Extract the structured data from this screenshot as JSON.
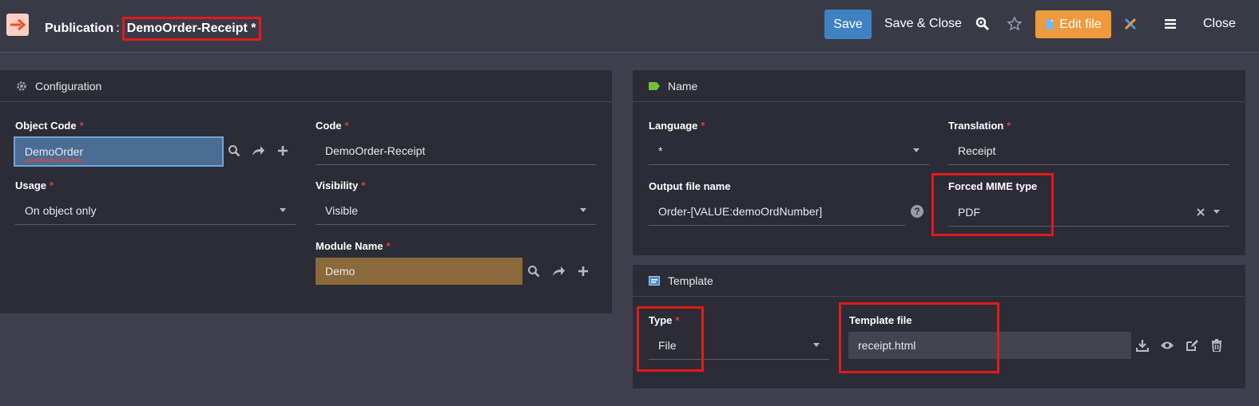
{
  "header": {
    "object_type": "Publication",
    "separator": ":",
    "record_name": "DemoOrder-Receipt *",
    "save_label": "Save",
    "save_close_label": "Save & Close",
    "edit_file_label": "Edit file",
    "close_label": "Close"
  },
  "configuration": {
    "title": "Configuration",
    "object_code": {
      "label": "Object Code",
      "value": "DemoOrder"
    },
    "code": {
      "label": "Code",
      "value": "DemoOrder-Receipt"
    },
    "usage": {
      "label": "Usage",
      "value": "On object only"
    },
    "visibility": {
      "label": "Visibility",
      "value": "Visible"
    },
    "module_name": {
      "label": "Module Name",
      "value": "Demo"
    }
  },
  "name_panel": {
    "title": "Name",
    "language": {
      "label": "Language",
      "value": "*"
    },
    "translation": {
      "label": "Translation",
      "value": "Receipt"
    },
    "output_file_name": {
      "label": "Output file name",
      "value": "Order-[VALUE:demoOrdNumber]"
    },
    "forced_mime": {
      "label": "Forced MIME type",
      "value": "PDF"
    }
  },
  "template_panel": {
    "title": "Template",
    "type": {
      "label": "Type",
      "value": "File"
    },
    "template_file": {
      "label": "Template file",
      "value": "receipt.html"
    }
  },
  "required_mark": "*",
  "colors": {
    "accent_blue": "#3f82c4",
    "accent_orange": "#ee9a3d",
    "required_red": "#e03c3c",
    "highlight_red": "#e11a1a",
    "gold_field": "#8a6a3a"
  }
}
